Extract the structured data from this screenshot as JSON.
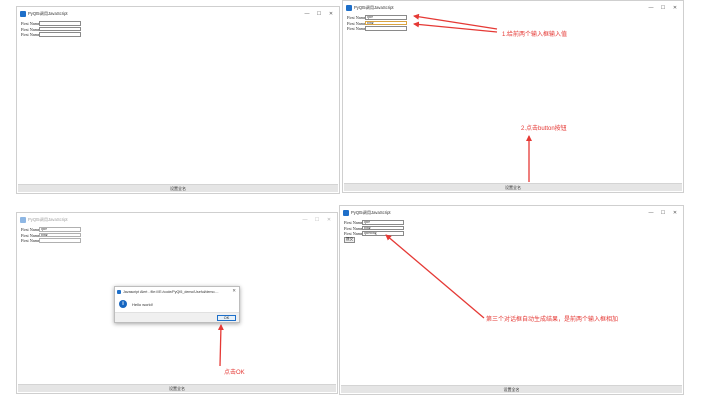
{
  "app_title": "PyQt5调用JavaScript",
  "window_controls": {
    "minimize": "—",
    "maximize": "☐",
    "close": "✕"
  },
  "labels": {
    "first_name": "First Name:"
  },
  "bottom_button": "设置全名",
  "submit_label": "提交",
  "panels": [
    {
      "values": [
        "",
        "",
        ""
      ]
    },
    {
      "values": [
        "qwe",
        "rong",
        ""
      ]
    },
    {
      "values": [
        "qwe",
        "rong",
        ""
      ]
    },
    {
      "values": [
        "qwe",
        "rong",
        "qwerong"
      ]
    }
  ],
  "dialog": {
    "title": "Javascript Alert - file:///E:/code/PyQt5_demo/Useful/demo....",
    "message": "Hello world!",
    "close": "✕",
    "ok_label": "OK"
  },
  "annotations": {
    "step1": "1.给前两个输入框输入值",
    "step2": "2.点击button按钮",
    "step3": "点击OK",
    "step4": "第三个对话框自动生成结果，是前两个输入框相加"
  },
  "colors": {
    "annotation": "#e53935",
    "focus_border": "#d9a441",
    "accent": "#1e6fc9"
  }
}
